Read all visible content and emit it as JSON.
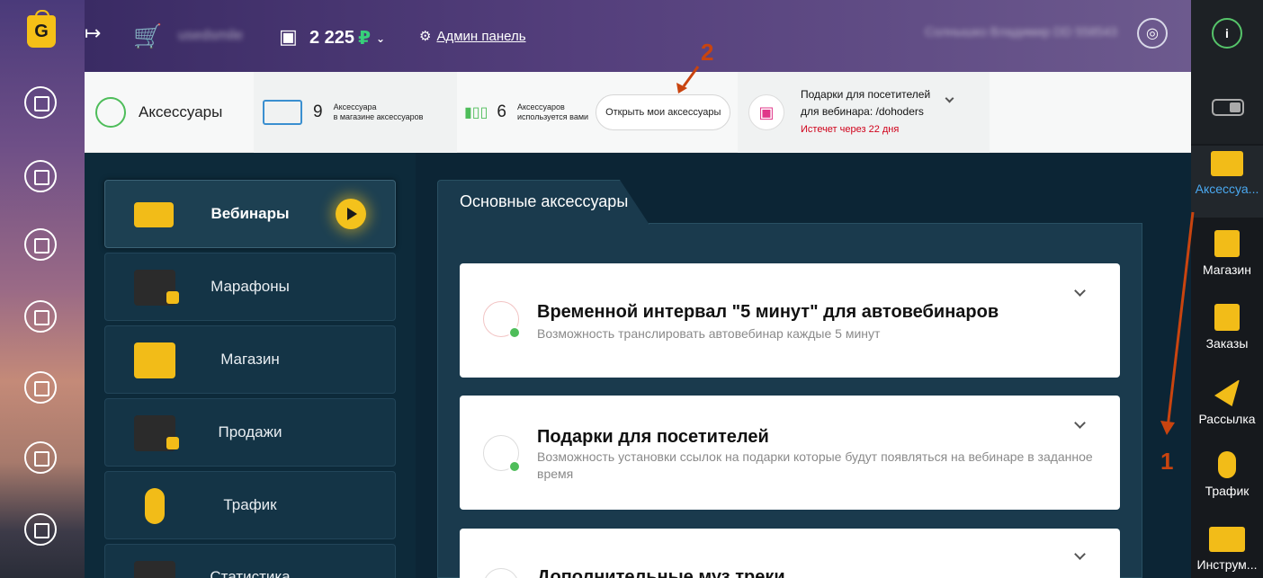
{
  "topbar": {
    "username": "usedsmile",
    "balance": "2 225",
    "currency": "₽",
    "admin_panel": "Админ панель",
    "account_name": "Солнышко Владимир DD 558543"
  },
  "subheader": {
    "title": "Аксессуары",
    "store_count": "9",
    "store_label_1": "Аксессуара",
    "store_label_2": "в магазине аксессуаров",
    "used_count": "6",
    "used_label_1": "Аксессуаров",
    "used_label_2": "используется вами",
    "open_button": "Открыть мои аксессуары",
    "gift_title_1": "Подарки для посетителей",
    "gift_title_2": "для вебинара: /dohoders",
    "gift_expiry": "Истечет через 22 дня"
  },
  "menu": {
    "items": [
      {
        "label": "Вебинары"
      },
      {
        "label": "Марафоны"
      },
      {
        "label": "Магазин"
      },
      {
        "label": "Продажи"
      },
      {
        "label": "Трафик"
      },
      {
        "label": "Статистика"
      }
    ]
  },
  "panel": {
    "tab": "Основные аксессуары",
    "cards": [
      {
        "title": "Временной интервал \"5 минут\" для автовебинаров",
        "desc": "Возможность транслировать автовебинар каждые 5 минут"
      },
      {
        "title": "Подарки для посетителей",
        "desc": "Возможность установки ссылок на подарки которые будут появляться на вебинаре в заданное время"
      },
      {
        "title": "Дополнительные муз треки",
        "desc": ""
      }
    ]
  },
  "rightrail": {
    "info": "i",
    "items": [
      {
        "label": "Аксессуа..."
      },
      {
        "label": "Магазин"
      },
      {
        "label": "Заказы"
      },
      {
        "label": "Рассылка"
      },
      {
        "label": "Трафик"
      },
      {
        "label": "Инструм..."
      }
    ]
  },
  "annotations": {
    "one": "1",
    "two": "2"
  },
  "colors": {
    "accent_yellow": "#f2bc18",
    "annotation": "#c9440f",
    "active_blue": "#4aa8f0",
    "expiry_red": "#d0021b"
  }
}
